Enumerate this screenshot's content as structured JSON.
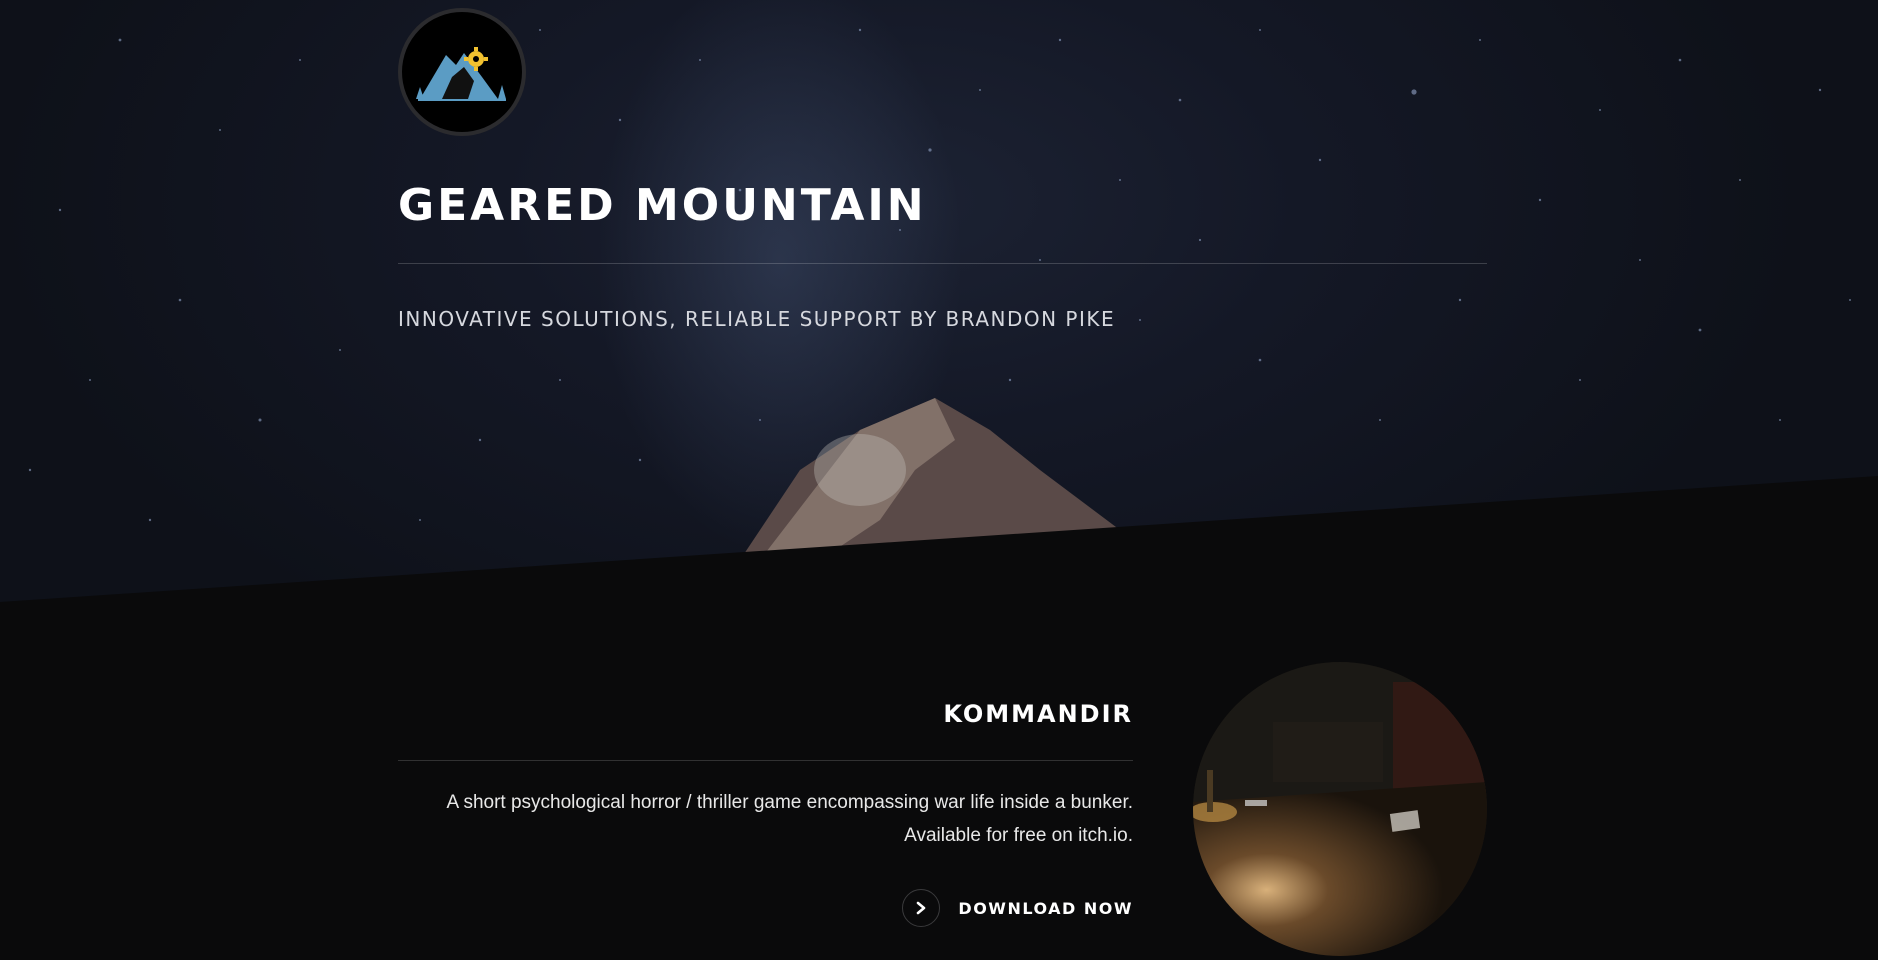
{
  "header": {
    "title": "GEARED MOUNTAIN",
    "tagline": "INNOVATIVE SOLUTIONS, RELIABLE SUPPORT BY BRANDON PIKE",
    "logo_icon": "mountain-gear-logo"
  },
  "project": {
    "title": "KOMMANDIR",
    "description": "A short psychological horror / thriller game encompassing war life inside a bunker. Available for free on itch.io.",
    "download_label": "DOWNLOAD NOW",
    "download_icon": "chevron-right-icon",
    "image_icon": "bunker-desk-image"
  },
  "colors": {
    "background": "#0a0a0b",
    "logo_blue": "#5b9cc4",
    "logo_gear": "#f2c230"
  }
}
